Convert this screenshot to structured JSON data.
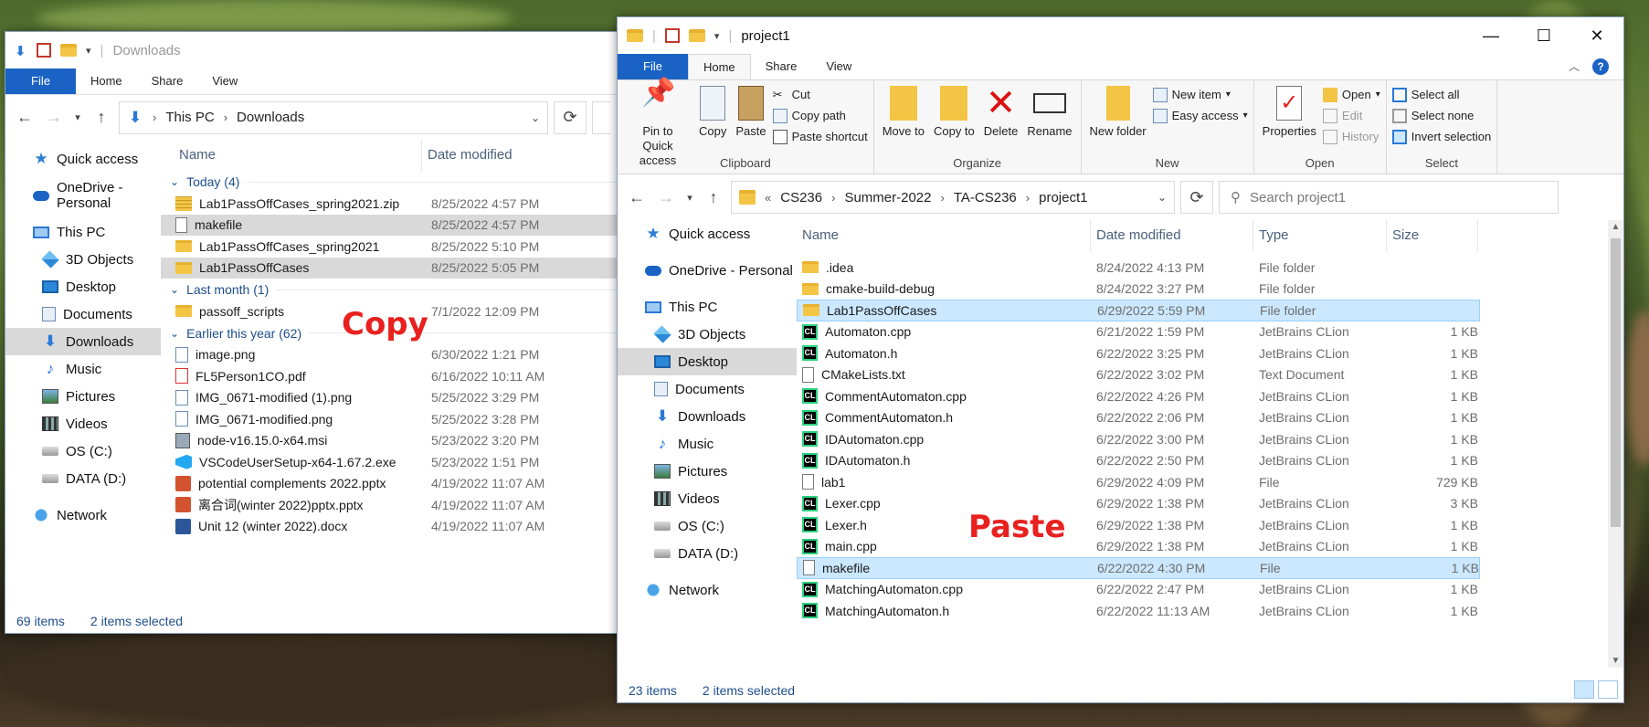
{
  "annotations": {
    "copy": "Copy",
    "paste": "Paste"
  },
  "left_window": {
    "title": "Downloads",
    "tabs": [
      "File",
      "Home",
      "Share",
      "View"
    ],
    "address": {
      "root": "This PC",
      "current": "Downloads"
    },
    "columns": {
      "name": "Name",
      "date": "Date modified"
    },
    "nav": [
      {
        "label": "Quick access",
        "icon": "star-icon"
      },
      {
        "label": "OneDrive - Personal",
        "icon": "cloud-icon"
      },
      {
        "label": "This PC",
        "icon": "pc-icon"
      },
      {
        "label": "3D Objects",
        "icon": "cube-icon"
      },
      {
        "label": "Desktop",
        "icon": "desktop-icon"
      },
      {
        "label": "Documents",
        "icon": "documents-icon"
      },
      {
        "label": "Downloads",
        "icon": "download-icon"
      },
      {
        "label": "Music",
        "icon": "music-icon"
      },
      {
        "label": "Pictures",
        "icon": "pictures-icon"
      },
      {
        "label": "Videos",
        "icon": "videos-icon"
      },
      {
        "label": "OS (C:)",
        "icon": "drive-icon"
      },
      {
        "label": "DATA (D:)",
        "icon": "drive-icon"
      },
      {
        "label": "Network",
        "icon": "network-icon"
      }
    ],
    "groups": [
      {
        "label": "Today (4)",
        "rows": [
          {
            "name": "Lab1PassOffCases_spring2021.zip",
            "date": "8/25/2022 4:57 PM",
            "icon": "zip"
          },
          {
            "name": "makefile",
            "date": "8/25/2022 4:57 PM",
            "icon": "file"
          },
          {
            "name": "Lab1PassOffCases_spring2021",
            "date": "8/25/2022 5:10 PM",
            "icon": "folder"
          },
          {
            "name": "Lab1PassOffCases",
            "date": "8/25/2022 5:05 PM",
            "icon": "folder"
          }
        ]
      },
      {
        "label": "Last month (1)",
        "rows": [
          {
            "name": "passoff_scripts",
            "date": "7/1/2022 12:09 PM",
            "icon": "folder"
          }
        ]
      },
      {
        "label": "Earlier this year (62)",
        "rows": [
          {
            "name": "image.png",
            "date": "6/30/2022 1:21 PM",
            "icon": "img"
          },
          {
            "name": "FL5Person1CO.pdf",
            "date": "6/16/2022 10:11 AM",
            "icon": "pdf"
          },
          {
            "name": "IMG_0671-modified (1).png",
            "date": "5/25/2022 3:29 PM",
            "icon": "img"
          },
          {
            "name": "IMG_0671-modified.png",
            "date": "5/25/2022 3:28 PM",
            "icon": "img"
          },
          {
            "name": "node-v16.15.0-x64.msi",
            "date": "5/23/2022 3:20 PM",
            "icon": "msi"
          },
          {
            "name": "VSCodeUserSetup-x64-1.67.2.exe",
            "date": "5/23/2022 1:51 PM",
            "icon": "vs"
          },
          {
            "name": "potential complements 2022.pptx",
            "date": "4/19/2022 11:07 AM",
            "icon": "ppt"
          },
          {
            "name": "离合词(winter 2022)pptx.pptx",
            "date": "4/19/2022 11:07 AM",
            "icon": "ppt"
          },
          {
            "name": "Unit 12 (winter 2022).docx",
            "date": "4/19/2022 11:07 AM",
            "icon": "doc"
          }
        ]
      }
    ],
    "status": {
      "count": "69 items",
      "selected": "2 items selected"
    }
  },
  "right_window": {
    "title": "project1",
    "tabs": [
      "File",
      "Home",
      "Share",
      "View"
    ],
    "ribbon": {
      "clipboard": {
        "label": "Clipboard",
        "pin": "Pin to Quick access",
        "copy": "Copy",
        "paste": "Paste",
        "cut": "Cut",
        "copy_path": "Copy path",
        "paste_shortcut": "Paste shortcut"
      },
      "organize": {
        "label": "Organize",
        "move_to": "Move to",
        "copy_to": "Copy to",
        "delete": "Delete",
        "rename": "Rename"
      },
      "new": {
        "label": "New",
        "new_folder": "New folder",
        "new_item": "New item",
        "easy_access": "Easy access"
      },
      "open": {
        "label": "Open",
        "properties": "Properties",
        "open": "Open",
        "edit": "Edit",
        "history": "History"
      },
      "select": {
        "label": "Select",
        "select_all": "Select all",
        "select_none": "Select none",
        "invert": "Invert selection"
      }
    },
    "address": {
      "prefix": "«",
      "crumbs": [
        "CS236",
        "Summer-2022",
        "TA-CS236",
        "project1"
      ]
    },
    "search_placeholder": "Search project1",
    "columns": {
      "name": "Name",
      "date": "Date modified",
      "type": "Type",
      "size": "Size"
    },
    "nav": [
      {
        "label": "Quick access",
        "icon": "star-icon"
      },
      {
        "label": "OneDrive - Personal",
        "icon": "cloud-icon"
      },
      {
        "label": "This PC",
        "icon": "pc-icon"
      },
      {
        "label": "3D Objects",
        "icon": "cube-icon"
      },
      {
        "label": "Desktop",
        "icon": "desktop-icon"
      },
      {
        "label": "Documents",
        "icon": "documents-icon"
      },
      {
        "label": "Downloads",
        "icon": "download-icon"
      },
      {
        "label": "Music",
        "icon": "music-icon"
      },
      {
        "label": "Pictures",
        "icon": "pictures-icon"
      },
      {
        "label": "Videos",
        "icon": "videos-icon"
      },
      {
        "label": "OS (C:)",
        "icon": "drive-icon"
      },
      {
        "label": "DATA (D:)",
        "icon": "drive-icon"
      },
      {
        "label": "Network",
        "icon": "network-icon"
      }
    ],
    "rows": [
      {
        "name": ".idea",
        "date": "8/24/2022 4:13 PM",
        "type": "File folder",
        "size": "",
        "icon": "folder"
      },
      {
        "name": "cmake-build-debug",
        "date": "8/24/2022 3:27 PM",
        "type": "File folder",
        "size": "",
        "icon": "folder"
      },
      {
        "name": "Lab1PassOffCases",
        "date": "6/29/2022 5:59 PM",
        "type": "File folder",
        "size": "",
        "icon": "folder"
      },
      {
        "name": "Automaton.cpp",
        "date": "6/21/2022 1:59 PM",
        "type": "JetBrains CLion",
        "size": "1 KB",
        "icon": "cl"
      },
      {
        "name": "Automaton.h",
        "date": "6/22/2022 3:25 PM",
        "type": "JetBrains CLion",
        "size": "1 KB",
        "icon": "cl"
      },
      {
        "name": "CMakeLists.txt",
        "date": "6/22/2022 3:02 PM",
        "type": "Text Document",
        "size": "1 KB",
        "icon": "file"
      },
      {
        "name": "CommentAutomaton.cpp",
        "date": "6/22/2022 4:26 PM",
        "type": "JetBrains CLion",
        "size": "1 KB",
        "icon": "cl"
      },
      {
        "name": "CommentAutomaton.h",
        "date": "6/22/2022 2:06 PM",
        "type": "JetBrains CLion",
        "size": "1 KB",
        "icon": "cl"
      },
      {
        "name": "IDAutomaton.cpp",
        "date": "6/22/2022 3:00 PM",
        "type": "JetBrains CLion",
        "size": "1 KB",
        "icon": "cl"
      },
      {
        "name": "IDAutomaton.h",
        "date": "6/22/2022 2:50 PM",
        "type": "JetBrains CLion",
        "size": "1 KB",
        "icon": "cl"
      },
      {
        "name": "lab1",
        "date": "6/29/2022 4:09 PM",
        "type": "File",
        "size": "729 KB",
        "icon": "file"
      },
      {
        "name": "Lexer.cpp",
        "date": "6/29/2022 1:38 PM",
        "type": "JetBrains CLion",
        "size": "3 KB",
        "icon": "cl"
      },
      {
        "name": "Lexer.h",
        "date": "6/29/2022 1:38 PM",
        "type": "JetBrains CLion",
        "size": "1 KB",
        "icon": "cl"
      },
      {
        "name": "main.cpp",
        "date": "6/29/2022 1:38 PM",
        "type": "JetBrains CLion",
        "size": "1 KB",
        "icon": "cl"
      },
      {
        "name": "makefile",
        "date": "6/22/2022 4:30 PM",
        "type": "File",
        "size": "1 KB",
        "icon": "file"
      },
      {
        "name": "MatchingAutomaton.cpp",
        "date": "6/22/2022 2:47 PM",
        "type": "JetBrains CLion",
        "size": "1 KB",
        "icon": "cl"
      },
      {
        "name": "MatchingAutomaton.h",
        "date": "6/22/2022 11:13 AM",
        "type": "JetBrains CLion",
        "size": "1 KB",
        "icon": "cl"
      }
    ],
    "status": {
      "count": "23 items",
      "selected": "2 items selected"
    }
  }
}
